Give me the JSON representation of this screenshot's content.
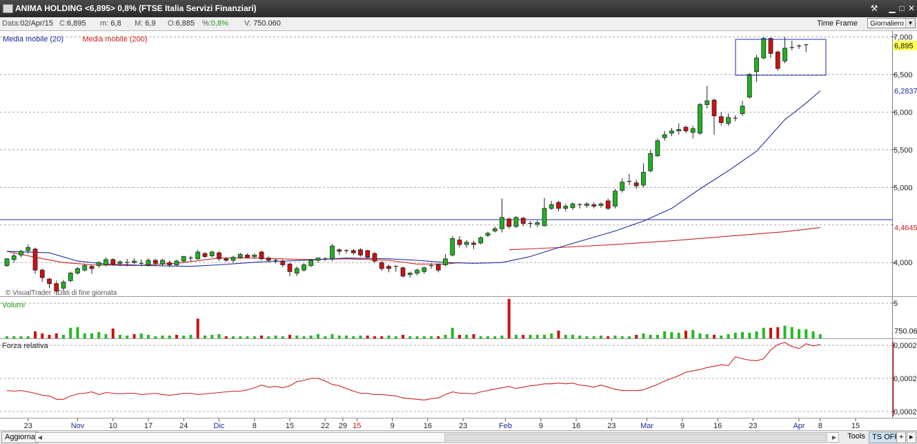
{
  "window": {
    "title": "ANIMA HOLDING <6,895> 0,8%  (FTSE Italia Servizi Finanziari)"
  },
  "info": {
    "data_label": "Data:",
    "data_value": "02/Apr/15",
    "c_label": "C:",
    "c_value": "6,895",
    "m_label": "m:",
    "m_value": "6,8",
    "M_label": "M:",
    "M_value": "6,9",
    "o_label": "O:",
    "o_value": "6,885",
    "pct_label": "%:",
    "pct_value": "0,8%",
    "v_label": "V:",
    "v_value": "750.060",
    "timeframe_label": "Time Frame",
    "timeframe_value": "Giornaliero"
  },
  "bottom": {
    "aggiorna": "Aggiorna",
    "tools": "Tools",
    "tsoff": "TS OFF"
  },
  "colors": {
    "up": "#22b122",
    "down": "#cc1111",
    "ma20": "#1c2a9c",
    "ma200": "#cc2222",
    "volume": "#22bb22",
    "volume_down": "#cc1111",
    "rs": "#cc2222"
  },
  "chart_data": {
    "type": "candlestick",
    "price_panel": {
      "legend": [
        {
          "name": "Media mobile (20)",
          "color": "#1c2a9c"
        },
        {
          "name": "Media mobile (200)",
          "color": "#cc2222"
        }
      ],
      "watermark": "© VisualTrader - Dati di fine giornata",
      "y_ticks": [
        "4,000",
        "4,500",
        "5,000",
        "5,500",
        "6,000",
        "6,500",
        "7,000"
      ],
      "ylim": [
        3.58,
        7.05
      ],
      "last_price_label": "6,895",
      "ma20_label": "6,2837",
      "ma200_label": "4,4645",
      "horizontal_line": 4.57,
      "candles": [
        [
          3.96,
          4.05,
          3.94,
          4.06
        ],
        [
          4.04,
          4.09,
          4.0,
          4.12
        ],
        [
          4.1,
          4.15,
          4.07,
          4.17
        ],
        [
          4.16,
          4.2,
          4.12,
          4.24
        ],
        [
          4.18,
          3.9,
          3.85,
          4.2
        ],
        [
          3.9,
          3.8,
          3.74,
          3.92
        ],
        [
          3.78,
          3.72,
          3.66,
          3.8
        ],
        [
          3.72,
          3.62,
          3.57,
          3.76
        ],
        [
          3.66,
          3.74,
          3.62,
          3.77
        ],
        [
          3.76,
          3.86,
          3.74,
          3.88
        ],
        [
          3.86,
          3.92,
          3.84,
          3.94
        ],
        [
          3.9,
          3.96,
          3.88,
          3.98
        ],
        [
          3.95,
          3.92,
          3.85,
          3.97
        ],
        [
          3.96,
          4.0,
          3.93,
          4.02
        ],
        [
          3.97,
          4.04,
          3.95,
          4.07
        ],
        [
          4.04,
          3.98,
          3.96,
          4.06
        ],
        [
          3.99,
          4.01,
          3.95,
          4.03
        ],
        [
          4.0,
          4.0,
          3.95,
          4.05
        ],
        [
          4.0,
          4.02,
          3.98,
          4.06
        ],
        [
          3.98,
          3.99,
          3.95,
          4.04
        ],
        [
          3.97,
          4.03,
          3.95,
          4.06
        ],
        [
          4.03,
          3.99,
          3.96,
          4.05
        ],
        [
          3.98,
          4.03,
          3.96,
          4.05
        ],
        [
          4.0,
          3.97,
          3.94,
          4.03
        ],
        [
          3.97,
          4.02,
          3.95,
          4.04
        ],
        [
          4.02,
          4.08,
          4.0,
          4.09
        ],
        [
          4.06,
          4.05,
          4.02,
          4.09
        ],
        [
          4.05,
          4.14,
          4.04,
          4.17
        ],
        [
          4.12,
          4.08,
          4.06,
          4.14
        ],
        [
          4.09,
          4.14,
          4.07,
          4.16
        ],
        [
          4.13,
          4.05,
          4.02,
          4.15
        ],
        [
          4.05,
          4.03,
          4.01,
          4.07
        ],
        [
          4.03,
          4.07,
          4.0,
          4.09
        ],
        [
          4.07,
          4.11,
          4.05,
          4.13
        ],
        [
          4.1,
          4.07,
          4.06,
          4.12
        ],
        [
          4.08,
          4.1,
          4.05,
          4.12
        ],
        [
          4.14,
          4.05,
          4.03,
          4.16
        ],
        [
          4.06,
          4.03,
          4.0,
          4.08
        ],
        [
          4.03,
          4.02,
          3.99,
          4.05
        ],
        [
          4.02,
          3.97,
          3.94,
          4.04
        ],
        [
          3.98,
          3.88,
          3.82,
          4.0
        ],
        [
          3.86,
          3.92,
          3.82,
          3.95
        ],
        [
          3.9,
          3.97,
          3.88,
          3.99
        ],
        [
          3.96,
          4.03,
          3.94,
          4.05
        ],
        [
          4.03,
          4.06,
          4.0,
          4.07
        ],
        [
          4.05,
          4.04,
          4.02,
          4.07
        ],
        [
          4.05,
          4.22,
          4.02,
          4.25
        ],
        [
          4.17,
          4.15,
          4.1,
          4.19
        ],
        [
          4.15,
          4.16,
          4.12,
          4.18
        ],
        [
          4.16,
          4.13,
          4.1,
          4.18
        ],
        [
          4.17,
          4.1,
          4.08,
          4.19
        ],
        [
          4.16,
          4.07,
          4.05,
          4.17
        ],
        [
          4.12,
          4.02,
          3.99,
          4.14
        ],
        [
          4.0,
          3.92,
          3.89,
          4.02
        ],
        [
          3.95,
          3.92,
          3.87,
          3.97
        ],
        [
          3.94,
          3.95,
          3.88,
          3.96
        ],
        [
          3.93,
          3.82,
          3.8,
          3.95
        ],
        [
          3.84,
          3.86,
          3.8,
          3.88
        ],
        [
          3.86,
          3.9,
          3.83,
          3.92
        ],
        [
          3.88,
          3.93,
          3.85,
          3.95
        ],
        [
          3.95,
          3.96,
          3.92,
          3.99
        ],
        [
          3.97,
          3.9,
          3.87,
          3.99
        ],
        [
          3.97,
          4.05,
          3.95,
          4.11
        ],
        [
          4.1,
          4.32,
          4.08,
          4.35
        ],
        [
          4.3,
          4.24,
          4.2,
          4.35
        ],
        [
          4.24,
          4.27,
          4.2,
          4.3
        ],
        [
          4.26,
          4.24,
          4.18,
          4.29
        ],
        [
          4.26,
          4.33,
          4.24,
          4.35
        ],
        [
          4.36,
          4.39,
          4.34,
          4.41
        ],
        [
          4.42,
          4.45,
          4.4,
          4.48
        ],
        [
          4.45,
          4.6,
          4.4,
          4.85
        ],
        [
          4.58,
          4.48,
          4.45,
          4.6
        ],
        [
          4.48,
          4.6,
          4.46,
          4.62
        ],
        [
          4.59,
          4.52,
          4.48,
          4.61
        ],
        [
          4.52,
          4.51,
          4.46,
          4.55
        ],
        [
          4.51,
          4.53,
          4.47,
          4.56
        ],
        [
          4.49,
          4.72,
          4.48,
          4.86
        ],
        [
          4.72,
          4.77,
          4.7,
          4.82
        ],
        [
          4.8,
          4.72,
          4.68,
          4.82
        ],
        [
          4.72,
          4.75,
          4.68,
          4.78
        ],
        [
          4.73,
          4.78,
          4.7,
          4.8
        ],
        [
          4.77,
          4.76,
          4.72,
          4.79
        ],
        [
          4.76,
          4.78,
          4.73,
          4.8
        ],
        [
          4.77,
          4.75,
          4.72,
          4.8
        ],
        [
          4.76,
          4.78,
          4.73,
          4.8
        ],
        [
          4.82,
          4.72,
          4.7,
          4.85
        ],
        [
          4.75,
          4.95,
          4.72,
          4.98
        ],
        [
          4.96,
          5.07,
          4.93,
          5.12
        ],
        [
          5.07,
          5.08,
          5.03,
          5.18
        ],
        [
          5.06,
          5.02,
          4.98,
          5.1
        ],
        [
          5.03,
          5.2,
          5.0,
          5.32
        ],
        [
          5.22,
          5.45,
          5.2,
          5.5
        ],
        [
          5.42,
          5.62,
          5.4,
          5.65
        ],
        [
          5.66,
          5.7,
          5.62,
          5.75
        ],
        [
          5.72,
          5.75,
          5.68,
          5.79
        ],
        [
          5.75,
          5.77,
          5.7,
          5.85
        ],
        [
          5.8,
          5.75,
          5.72,
          5.82
        ],
        [
          5.73,
          5.78,
          5.65,
          5.82
        ],
        [
          5.72,
          6.1,
          5.7,
          6.12
        ],
        [
          6.1,
          6.15,
          6.05,
          6.35
        ],
        [
          6.16,
          5.95,
          5.7,
          6.18
        ],
        [
          5.94,
          5.86,
          5.82,
          6.0
        ],
        [
          5.85,
          5.93,
          5.82,
          5.98
        ],
        [
          5.92,
          5.92,
          5.88,
          5.96
        ],
        [
          5.98,
          6.08,
          5.95,
          6.15
        ],
        [
          6.2,
          6.5,
          6.18,
          6.52
        ],
        [
          6.54,
          6.72,
          6.4,
          6.76
        ],
        [
          6.72,
          6.98,
          6.7,
          7.0
        ],
        [
          6.98,
          6.78,
          6.72,
          6.99
        ],
        [
          6.8,
          6.58,
          6.55,
          6.82
        ],
        [
          6.68,
          6.85,
          6.65,
          7.0
        ],
        [
          6.85,
          6.86,
          6.82,
          6.95
        ],
        [
          6.87,
          6.88,
          6.84,
          6.9
        ],
        [
          6.885,
          6.895,
          6.8,
          6.9
        ]
      ],
      "ma20": [
        [
          0,
          4.15
        ],
        [
          6,
          4.13
        ],
        [
          10,
          4.02
        ],
        [
          14,
          3.98
        ],
        [
          20,
          3.96
        ],
        [
          26,
          3.95
        ],
        [
          30,
          3.97
        ],
        [
          36,
          4.01
        ],
        [
          42,
          4.03
        ],
        [
          48,
          4.06
        ],
        [
          54,
          4.05
        ],
        [
          58,
          4.03
        ],
        [
          62,
          4.0
        ],
        [
          66,
          3.99
        ],
        [
          70,
          4.0
        ],
        [
          74,
          4.08
        ],
        [
          78,
          4.2
        ],
        [
          82,
          4.31
        ],
        [
          86,
          4.42
        ],
        [
          90,
          4.55
        ],
        [
          94,
          4.72
        ],
        [
          98,
          4.98
        ],
        [
          102,
          5.22
        ],
        [
          106,
          5.48
        ],
        [
          110,
          5.9
        ],
        [
          113,
          6.12
        ],
        [
          115,
          6.2837
        ]
      ],
      "ma200": [
        [
          71,
          4.17
        ],
        [
          78,
          4.2
        ],
        [
          86,
          4.24
        ],
        [
          94,
          4.29
        ],
        [
          102,
          4.35
        ],
        [
          110,
          4.41
        ],
        [
          115,
          4.4645
        ]
      ]
    },
    "volume_panel": {
      "label": "Volumi",
      "y_tick": "5",
      "last_label": "750.06",
      "ylim": [
        0,
        5.4
      ],
      "values": [
        0.3,
        0.3,
        0.3,
        0.3,
        1.0,
        0.7,
        0.5,
        0.7,
        0.5,
        1.5,
        1.6,
        0.7,
        0.7,
        0.9,
        0.6,
        1.4,
        0.5,
        0.4,
        0.6,
        0.7,
        0.5,
        0.3,
        0.4,
        0.4,
        0.5,
        0.4,
        0.5,
        2.8,
        0.4,
        0.5,
        0.6,
        0.3,
        0.3,
        0.3,
        0.3,
        0.3,
        0.4,
        0.3,
        0.4,
        0.3,
        0.5,
        0.4,
        0.3,
        0.4,
        0.6,
        0.3,
        0.6,
        0.4,
        0.4,
        0.3,
        0.4,
        0.4,
        0.3,
        0.3,
        0.4,
        0.3,
        0.5,
        0.3,
        0.3,
        0.3,
        0.3,
        0.3,
        0.5,
        1.5,
        0.5,
        0.5,
        0.6,
        0.3,
        0.3,
        0.3,
        0.4,
        5.6,
        0.5,
        0.5,
        0.5,
        0.5,
        0.5,
        0.7,
        1.1,
        0.5,
        0.5,
        0.4,
        0.3,
        0.3,
        0.4,
        0.3,
        0.4,
        0.3,
        0.3,
        0.5,
        0.7,
        0.5,
        0.5,
        1.0,
        0.9,
        0.8,
        1.1,
        1.2,
        0.7,
        0.6,
        0.5,
        0.4,
        0.6,
        0.8,
        0.9,
        0.8,
        1.0,
        1.5,
        1.5,
        1.6,
        1.8,
        1.6,
        1.3,
        1.3,
        1.0,
        0.6
      ],
      "down": [
        4,
        5,
        6,
        7,
        15,
        18,
        24,
        27,
        31,
        36,
        40,
        51,
        52,
        53,
        56,
        61,
        64,
        66,
        71,
        73,
        78,
        85,
        89,
        96,
        100,
        108,
        109
      ]
    },
    "rs_panel": {
      "label": "Forza relativa",
      "y_ticks": [
        "0,0002",
        "0,0002",
        "0,0002"
      ],
      "ylim": [
        0,
        1
      ],
      "values": [
        0.28,
        0.27,
        0.28,
        0.26,
        0.24,
        0.21,
        0.2,
        0.15,
        0.15,
        0.2,
        0.23,
        0.24,
        0.26,
        0.22,
        0.25,
        0.24,
        0.23,
        0.24,
        0.24,
        0.22,
        0.23,
        0.24,
        0.22,
        0.21,
        0.22,
        0.24,
        0.24,
        0.22,
        0.23,
        0.24,
        0.25,
        0.26,
        0.27,
        0.27,
        0.29,
        0.32,
        0.36,
        0.33,
        0.34,
        0.32,
        0.35,
        0.41,
        0.43,
        0.46,
        0.46,
        0.42,
        0.37,
        0.35,
        0.31,
        0.27,
        0.24,
        0.24,
        0.22,
        0.22,
        0.21,
        0.2,
        0.17,
        0.16,
        0.15,
        0.14,
        0.16,
        0.17,
        0.22,
        0.26,
        0.24,
        0.24,
        0.23,
        0.26,
        0.28,
        0.3,
        0.32,
        0.34,
        0.31,
        0.33,
        0.35,
        0.36,
        0.38,
        0.38,
        0.39,
        0.38,
        0.39,
        0.36,
        0.35,
        0.33,
        0.36,
        0.33,
        0.3,
        0.28,
        0.28,
        0.28,
        0.29,
        0.33,
        0.37,
        0.42,
        0.46,
        0.5,
        0.55,
        0.57,
        0.59,
        0.62,
        0.64,
        0.66,
        0.65,
        0.78,
        0.75,
        0.73,
        0.72,
        0.75,
        0.88,
        0.96,
        0.99,
        0.93,
        0.9,
        0.97,
        0.94,
        0.96
      ]
    },
    "x_ticks": [
      {
        "i": 3,
        "label": "23"
      },
      {
        "i": 10,
        "label": "Nov"
      },
      {
        "i": 15,
        "label": "10"
      },
      {
        "i": 20,
        "label": "17"
      },
      {
        "i": 25,
        "label": "24"
      },
      {
        "i": 30,
        "label": "Dic"
      },
      {
        "i": 35,
        "label": "8"
      },
      {
        "i": 40,
        "label": "15"
      },
      {
        "i": 45,
        "label": "22"
      },
      {
        "i": 47.5,
        "label": "29"
      },
      {
        "i": 49.5,
        "label": "15",
        "red": true
      },
      {
        "i": 54.5,
        "label": "9"
      },
      {
        "i": 59.5,
        "label": "16"
      },
      {
        "i": 64.5,
        "label": "23"
      },
      {
        "i": 70.5,
        "label": "Feb"
      },
      {
        "i": 75.5,
        "label": "9"
      },
      {
        "i": 80.5,
        "label": "16"
      },
      {
        "i": 85.5,
        "label": "23"
      },
      {
        "i": 90.5,
        "label": "Mar"
      },
      {
        "i": 95.5,
        "label": "9"
      },
      {
        "i": 100.5,
        "label": "16"
      },
      {
        "i": 105.5,
        "label": "23"
      },
      {
        "i": 112,
        "label": "Apr"
      },
      {
        "i": 115,
        "label": "8"
      },
      {
        "i": 120,
        "label": "15"
      }
    ]
  }
}
